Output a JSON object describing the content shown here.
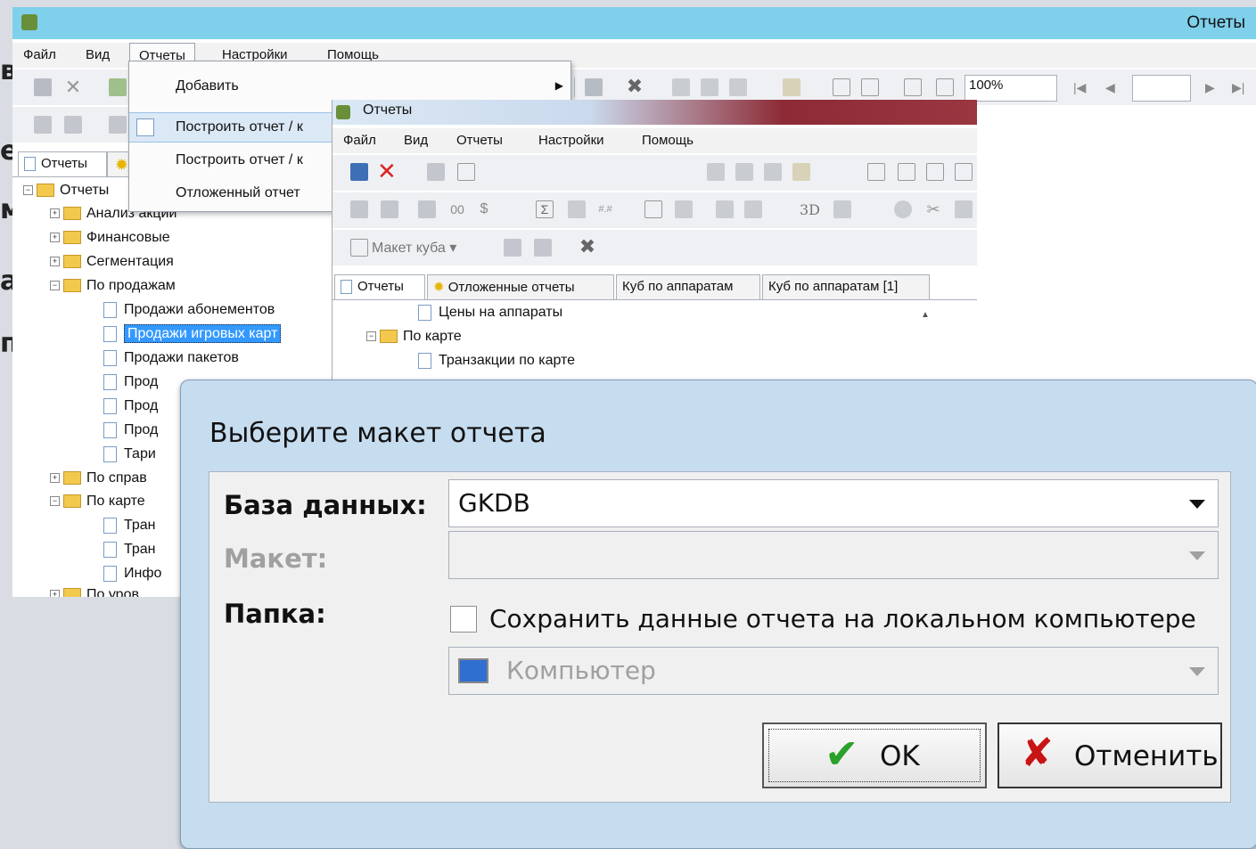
{
  "background_text_fragments": [
    "в",
    "е",
    "м",
    "а",
    "п"
  ],
  "main_window": {
    "title": "Отчеты",
    "menu": [
      "Файл",
      "Вид",
      "Отчеты",
      "Настройки",
      "Помощь"
    ],
    "zoom": "100%",
    "tabs": [
      "Отчеты"
    ],
    "tree": {
      "root": "Отчеты",
      "folders": [
        "Анализ акций",
        "Финансовые",
        "Сегментация",
        "По продажам"
      ],
      "items": [
        "Продажи абонементов",
        "Продажи игровых карт",
        "Продажи пакетов",
        "Прод",
        "Прод",
        "Прод",
        "Тари"
      ],
      "folders2": [
        "По справ",
        "По карте"
      ],
      "items2": [
        "Тран",
        "Тран",
        "Инфо"
      ],
      "cut": "По уров"
    }
  },
  "dropdown_menu": {
    "items": [
      "Добавить",
      "Построить отчет / к",
      "Построить отчет / к",
      "Отложенный отчет"
    ]
  },
  "second_window": {
    "title": "Отчеты",
    "menu": [
      "Файл",
      "Вид",
      "Отчеты",
      "Настройки",
      "Помощь"
    ],
    "toolbar_3d": "3D",
    "cube_button": "Макет куба",
    "tabs": [
      "Отчеты",
      "Отложенные отчеты",
      "Куб по аппаратам",
      "Куб по аппаратам [1]"
    ],
    "tree": [
      "Цены на аппараты",
      "По карте",
      "Транзакции по карте"
    ]
  },
  "dialog": {
    "title": "Выберите макет отчета",
    "db_label": "База данных:",
    "db_value": "GKDB",
    "layout_label": "Макет:",
    "folder_label": "Папка:",
    "save_local": "Сохранить данные отчета на локальном компьютере",
    "location": "Компьютер",
    "ok": "OK",
    "cancel": "Отменить"
  }
}
